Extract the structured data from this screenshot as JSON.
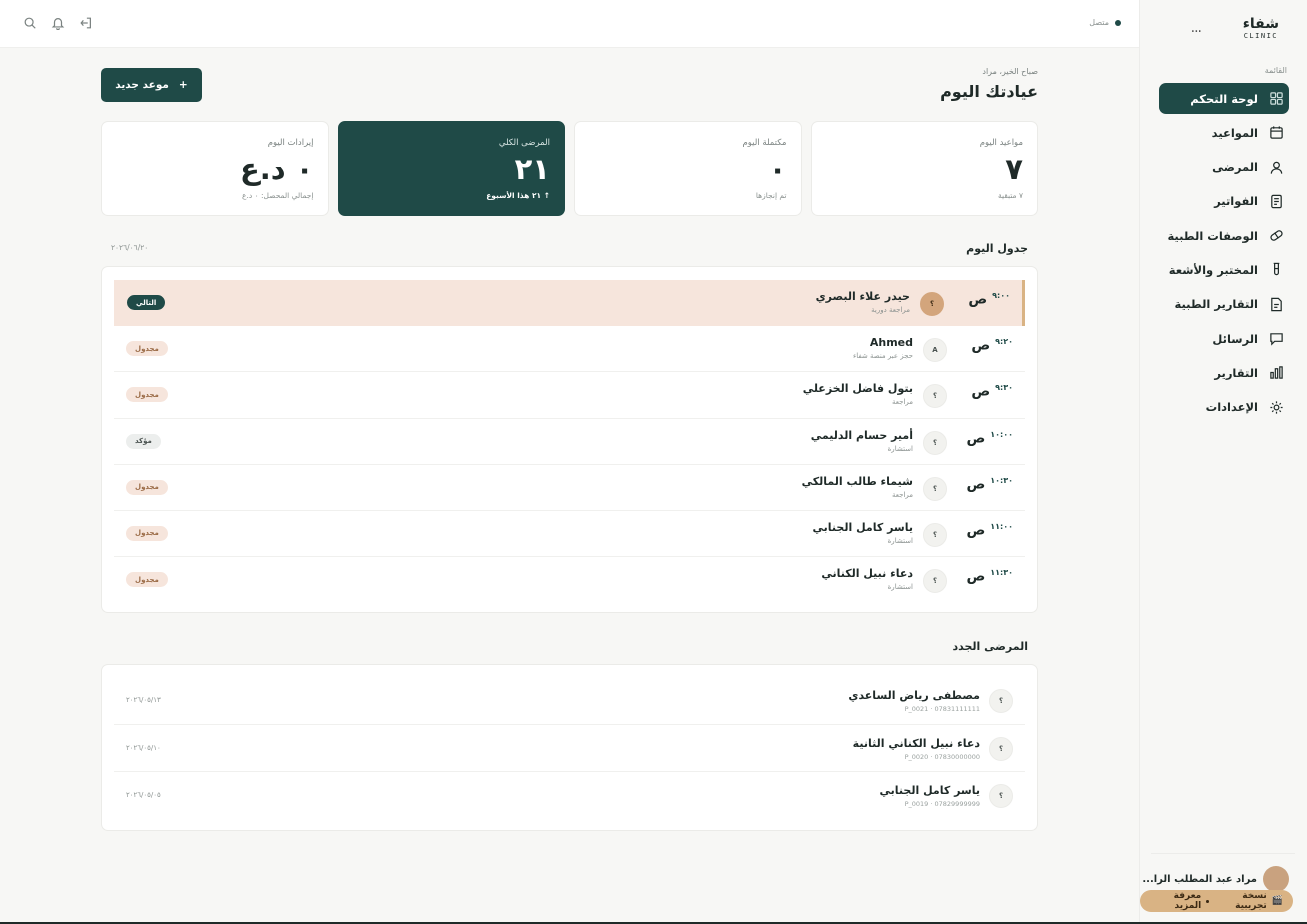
{
  "brand": {
    "name": "شفاء",
    "sub": "CLINIC",
    "menu_dots": "..."
  },
  "sidebar": {
    "caption": "القائمة",
    "items": [
      {
        "label": "لوحة التحكم",
        "icon": "dashboard-icon",
        "active": true
      },
      {
        "label": "المواعيد",
        "icon": "calendar-icon"
      },
      {
        "label": "المرضى",
        "icon": "user-icon"
      },
      {
        "label": "الفواتير",
        "icon": "invoice-icon"
      },
      {
        "label": "الوصفات الطبية",
        "icon": "pill-icon"
      },
      {
        "label": "المختبر والأشعة",
        "icon": "test-tube-icon"
      },
      {
        "label": "التقارير الطبية",
        "icon": "document-icon"
      },
      {
        "label": "الرسائل",
        "icon": "message-icon"
      },
      {
        "label": "التقارير",
        "icon": "bar-chart-icon"
      },
      {
        "label": "الإعدادات",
        "icon": "settings-icon"
      }
    ],
    "user_name": "مراد عبد المطلب الرا...",
    "trial_label": "نسخة تجريبية",
    "learn_more": "معرفة المزيد",
    "trial_icon": "🎬"
  },
  "topbar": {
    "status": "متصل"
  },
  "header": {
    "greeting": "صباح الخير، مراد",
    "title": "عيادتك اليوم",
    "new_button": "موعد جديد",
    "new_button_icon": "+"
  },
  "stats": [
    {
      "label": "مواعيد اليوم",
      "value": "٧",
      "note": "٧ متبقية",
      "dark": false
    },
    {
      "label": "مكتملة اليوم",
      "value": "٠",
      "note": "تم إنجازها",
      "dark": false
    },
    {
      "label": "المرضى الكلي",
      "value": "٢١",
      "note": "↑ ٢١ هذا الأسبوع",
      "dark": true
    },
    {
      "label": "إيرادات اليوم",
      "value": "٠ د.ع",
      "note": "إجمالي المحصل: ٠ د.ع",
      "dark": false
    }
  ],
  "schedule": {
    "title": "جدول اليوم",
    "date": "٢٠٢٦/٠٦/٢٠",
    "rows": [
      {
        "time": "٩:٠٠",
        "period": "ص",
        "avatar": "؟",
        "name": "حيدر علاء البصري",
        "type": "مراجعة دورية",
        "status": "التالي",
        "status_kind": "next",
        "current": true
      },
      {
        "time": "٩:٢٠",
        "period": "ص",
        "avatar": "A",
        "name": "Ahmed",
        "type": "حجز عبر منصة شفاء",
        "status": "مجدول",
        "status_kind": "scheduled"
      },
      {
        "time": "٩:٣٠",
        "period": "ص",
        "avatar": "؟",
        "name": "بتول فاضل الخزعلي",
        "type": "مراجعة",
        "status": "مجدول",
        "status_kind": "scheduled"
      },
      {
        "time": "١٠:٠٠",
        "period": "ص",
        "avatar": "؟",
        "name": "أمير حسام الدليمي",
        "type": "استشارة",
        "status": "مؤكد",
        "status_kind": "confirmed"
      },
      {
        "time": "١٠:٣٠",
        "period": "ص",
        "avatar": "؟",
        "name": "شيماء طالب المالكي",
        "type": "مراجعة",
        "status": "مجدول",
        "status_kind": "scheduled"
      },
      {
        "time": "١١:٠٠",
        "period": "ص",
        "avatar": "؟",
        "name": "ياسر كامل الجنابي",
        "type": "استشارة",
        "status": "مجدول",
        "status_kind": "scheduled"
      },
      {
        "time": "١١:٣٠",
        "period": "ص",
        "avatar": "؟",
        "name": "دعاء نبيل الكناني",
        "type": "استشارة",
        "status": "مجدول",
        "status_kind": "scheduled"
      }
    ]
  },
  "new_patients": {
    "title": "المرضى الجدد",
    "rows": [
      {
        "avatar": "؟",
        "name": "مصطفى رياض الساعدي",
        "meta": "P_0021 · 07831111111",
        "date": "٢٠٢٦/٠٥/١٣"
      },
      {
        "avatar": "؟",
        "name": "دعاء نبيل الكناني الثانية",
        "meta": "P_0020 · 07830000000",
        "date": "٢٠٢٦/٠٥/١٠"
      },
      {
        "avatar": "؟",
        "name": "ياسر كامل الجنابي",
        "meta": "P_0019 · 07829999999",
        "date": "٢٠٢٦/٠٥/٠٥"
      }
    ]
  }
}
